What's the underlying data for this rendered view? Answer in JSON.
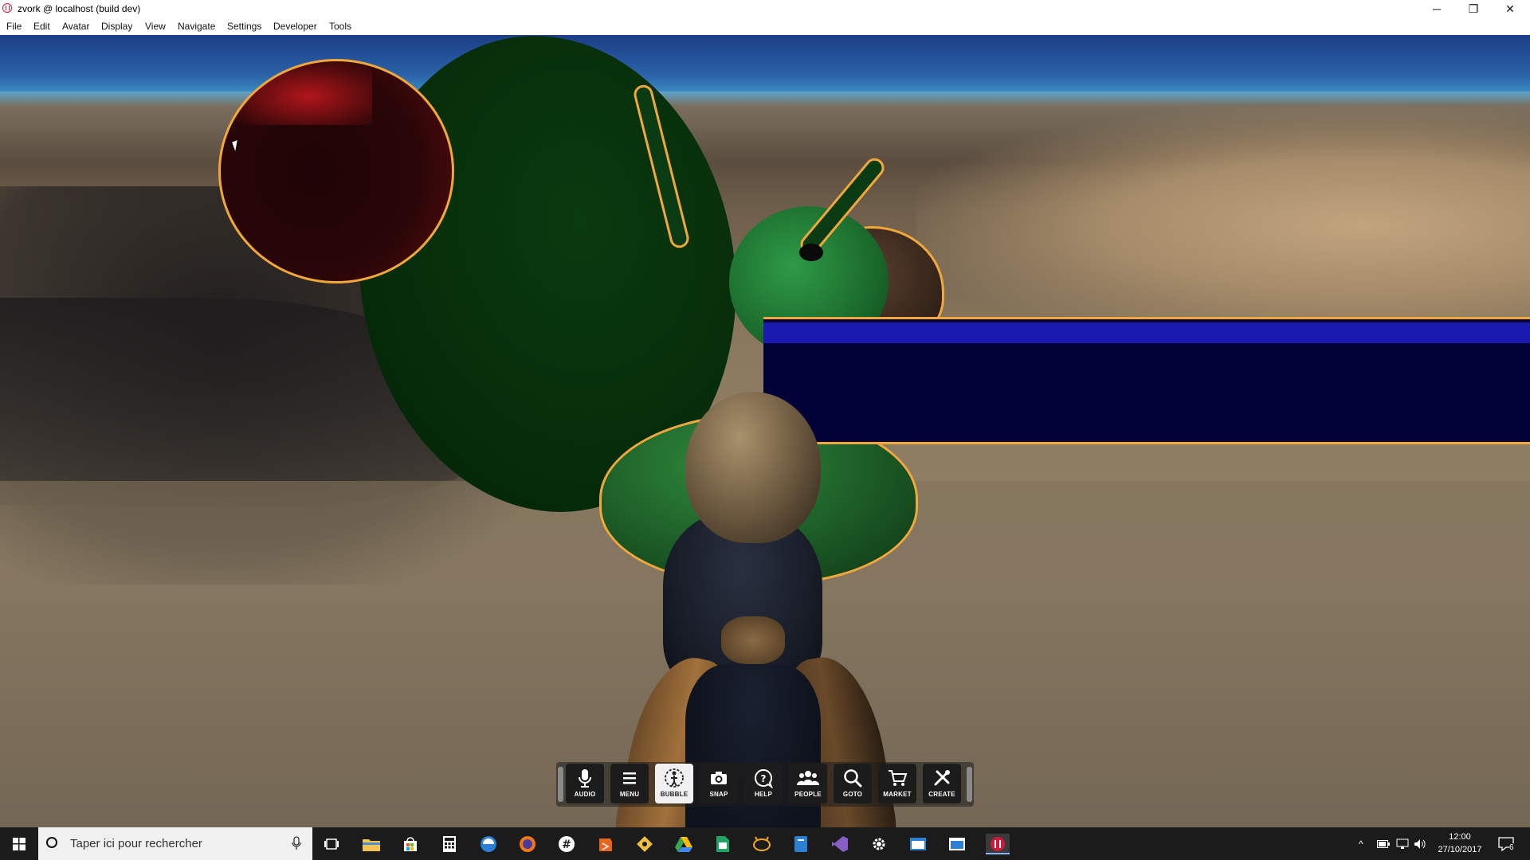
{
  "window": {
    "title": "zvork @ localhost (build dev)",
    "minimize": "─",
    "maximize": "❐",
    "close": "✕"
  },
  "menu": [
    "File",
    "Edit",
    "Avatar",
    "Display",
    "View",
    "Navigate",
    "Settings",
    "Developer",
    "Tools"
  ],
  "toolbar": {
    "buttons": [
      {
        "label": "AUDIO",
        "icon": "microphone-icon",
        "active": false
      },
      {
        "label": "MENU",
        "icon": "menu-icon",
        "active": false
      },
      {
        "label": "BUBBLE",
        "icon": "bubble-icon",
        "active": true
      },
      {
        "label": "SNAP",
        "icon": "camera-icon",
        "active": false
      },
      {
        "label": "HELP",
        "icon": "help-icon",
        "active": false
      },
      {
        "label": "PEOPLE",
        "icon": "people-icon",
        "active": false
      },
      {
        "label": "GOTO",
        "icon": "search-icon",
        "active": false
      },
      {
        "label": "MARKET",
        "icon": "cart-icon",
        "active": false
      },
      {
        "label": "CREATE",
        "icon": "tools-icon",
        "active": false
      }
    ]
  },
  "taskbar": {
    "search_placeholder": "Taper ici pour rechercher",
    "clock_time": "12:00",
    "clock_date": "27/10/2017",
    "notification_count": "6"
  },
  "colors": {
    "outline": "#f2a73a",
    "panel_blue": "#1a1ab0",
    "panel_dark": "#020238"
  }
}
